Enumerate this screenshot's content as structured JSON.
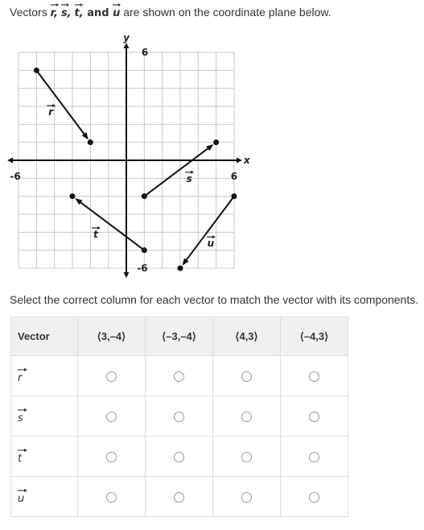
{
  "prompt": {
    "prefix": "Vectors ",
    "vectors": [
      "r,",
      "s,",
      "t,"
    ],
    "and": " and ",
    "last_vector": "u",
    "suffix": " are shown on the coordinate plane below."
  },
  "graph": {
    "x_axis_label": "x",
    "y_axis_label": "y",
    "x_min_label": "-6",
    "x_max_label": "6",
    "y_max_label": "6",
    "y_min_label": "-6",
    "range": [
      -6,
      6
    ],
    "vectors": [
      {
        "name": "r",
        "from": [
          -5,
          5
        ],
        "to": [
          -2,
          1
        ],
        "label_at": [
          -4.2,
          2.5
        ]
      },
      {
        "name": "s",
        "from": [
          1,
          -2
        ],
        "to": [
          5,
          1
        ],
        "label_at": [
          3.5,
          -1.2
        ]
      },
      {
        "name": "t",
        "from": [
          1,
          -5
        ],
        "to": [
          -3,
          -2
        ],
        "label_at": [
          -1.7,
          -4.3
        ]
      },
      {
        "name": "u",
        "from": [
          6,
          -2
        ],
        "to": [
          3,
          -6
        ],
        "label_at": [
          4.7,
          -4.8
        ]
      }
    ]
  },
  "instruction": "Select the correct column for each vector to match the vector with its components.",
  "table": {
    "header_first": "Vector",
    "columns": [
      "⟨3,–4⟩",
      "⟨–3,–4⟩",
      "⟨4,3⟩",
      "⟨–4,3⟩"
    ],
    "rows": [
      {
        "vector": "r",
        "selected": null
      },
      {
        "vector": "s",
        "selected": null
      },
      {
        "vector": "t",
        "selected": null
      },
      {
        "vector": "u",
        "selected": null
      }
    ]
  }
}
